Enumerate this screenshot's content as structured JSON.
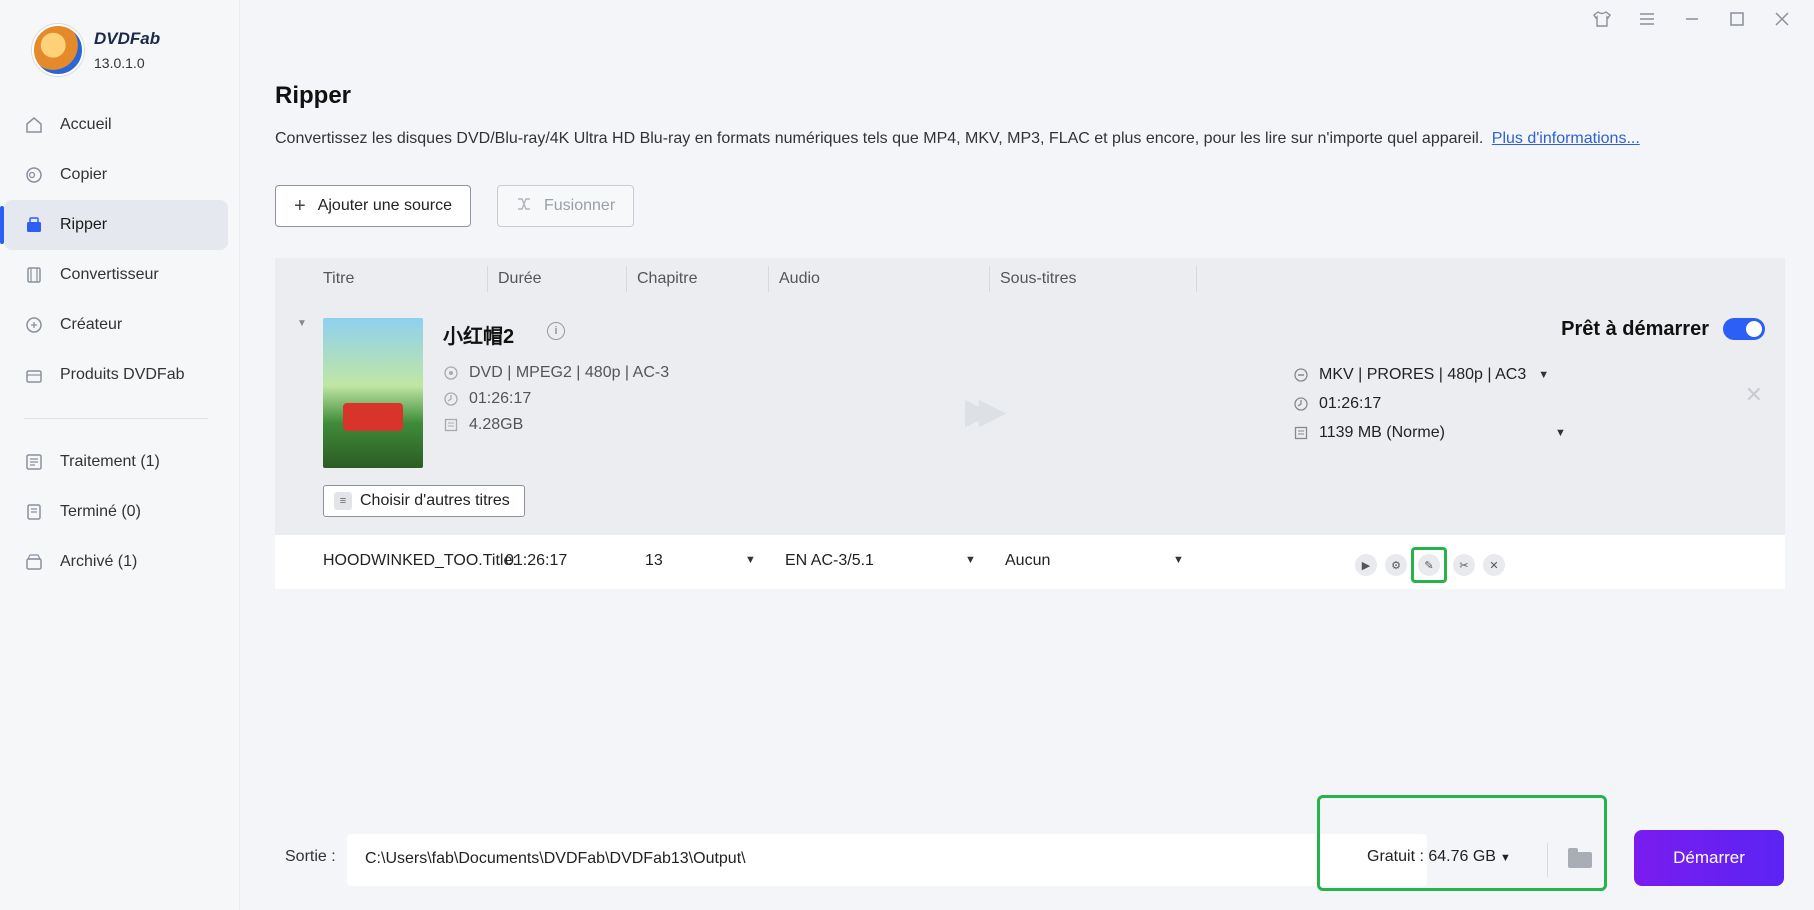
{
  "app": {
    "brand": "DVDFab",
    "version": "13.0.1.0"
  },
  "window_controls": [
    "shirt-icon",
    "menu-icon",
    "minimize-icon",
    "maximize-icon",
    "close-icon"
  ],
  "sidebar": {
    "items": [
      {
        "label": "Accueil",
        "icon": "home-icon"
      },
      {
        "label": "Copier",
        "icon": "copy-icon"
      },
      {
        "label": "Ripper",
        "icon": "ripper-icon",
        "active": true
      },
      {
        "label": "Convertisseur",
        "icon": "converter-icon"
      },
      {
        "label": "Créateur",
        "icon": "creator-icon"
      },
      {
        "label": "Produits DVDFab",
        "icon": "products-icon"
      }
    ],
    "queue": [
      {
        "label": "Traitement (1)",
        "icon": "processing-icon"
      },
      {
        "label": "Terminé (0)",
        "icon": "finished-icon"
      },
      {
        "label": "Archivé (1)",
        "icon": "archive-icon"
      }
    ]
  },
  "page": {
    "title": "Ripper",
    "description": "Convertissez les disques DVD/Blu-ray/4K Ultra HD Blu-ray en formats numériques tels que MP4, MKV, MP3, FLAC et plus encore, pour les lire sur n'importe quel appareil.",
    "more_link": "Plus d'informations...",
    "add_source": "Ajouter une source",
    "merge": "Fusionner"
  },
  "table": {
    "headers": [
      "Titre",
      "Durée",
      "Chapitre",
      "Audio",
      "Sous-titres"
    ]
  },
  "item": {
    "title": "小红帽2",
    "source_format": "DVD | MPEG2 | 480p | AC-3",
    "source_duration": "01:26:17",
    "source_size": "4.28GB",
    "choose_titles": "Choisir d'autres titres",
    "ready_label": "Prêt à démarrer",
    "ready_enabled": true,
    "output_format": "MKV | PRORES | 480p | AC3",
    "output_duration": "01:26:17",
    "output_size": "1139 MB (Norme)",
    "row": {
      "title": "HOODWINKED_TOO.Title:",
      "duration": "01:26:17",
      "chapter": "13",
      "audio": "EN  AC-3/5.1",
      "subtitles": "Aucun"
    }
  },
  "bottom": {
    "output_label": "Sortie :",
    "output_path": "C:\\Users\\fab\\Documents\\DVDFab\\DVDFab13\\Output\\",
    "free_space": "Gratuit : 64.76 GB",
    "start": "Démarrer"
  },
  "colors": {
    "accent": "#2c5ff6",
    "start_button": "#6a20f1",
    "highlight": "#27b34b"
  }
}
